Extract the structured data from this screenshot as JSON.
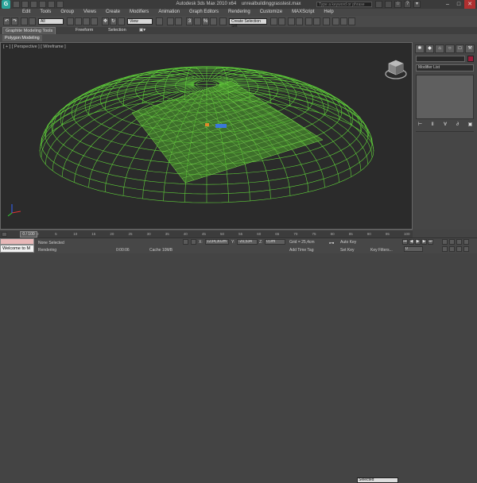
{
  "window": {
    "title": "Autodesk 3ds Max 2010 x64",
    "file": "unrealbuildinggrasstest.max",
    "app_icon": "3ds-max-logo-icon",
    "help_search_placeholder": "Type a keyword or phrase",
    "controls": [
      "–",
      "□",
      "✕"
    ]
  },
  "menu": [
    "Edit",
    "Tools",
    "Group",
    "Views",
    "Create",
    "Modifiers",
    "Animation",
    "Graph Editors",
    "Rendering",
    "Customize",
    "MAXScript",
    "Help"
  ],
  "toolbar": {
    "selection_filter": "All",
    "reference_coord": "View",
    "named_selection": "Create Selection Set"
  },
  "ribbon": {
    "tabs": [
      "Graphite Modeling Tools",
      "Freeform",
      "Selection"
    ],
    "sub_tab": "Polygon Modeling"
  },
  "viewport": {
    "label": "[ + ] [ Perspective ] [ Wireframe ]",
    "wire_color": "#5fd03a",
    "background": "#2b2b2b"
  },
  "command_panel": {
    "modifier_list": "Modifier List",
    "object_color": "#9b1d3a"
  },
  "time_slider": {
    "handle": "0 / 100",
    "ticks": [
      "0",
      "5",
      "10",
      "15",
      "20",
      "25",
      "30",
      "35",
      "40",
      "45",
      "50",
      "55",
      "60",
      "65",
      "70",
      "75",
      "80",
      "85",
      "90",
      "95",
      "100"
    ]
  },
  "status": {
    "maxscript_text": "Welcome to M",
    "selection": "None Selected",
    "prompt": "Rendering",
    "render_time": "0:00:06",
    "x_value": "1234,302m",
    "y_value": "-20,534",
    "z_value": "0,0m",
    "grid": "Grid = 25,4cm",
    "add_time_tag": "Add Time Tag",
    "auto_key": "Auto Key",
    "auto_key_mode": "Selected",
    "set_key": "Set Key",
    "key_filters": "Key Filters...",
    "frame": "0",
    "cache": "Cache 10MB"
  }
}
